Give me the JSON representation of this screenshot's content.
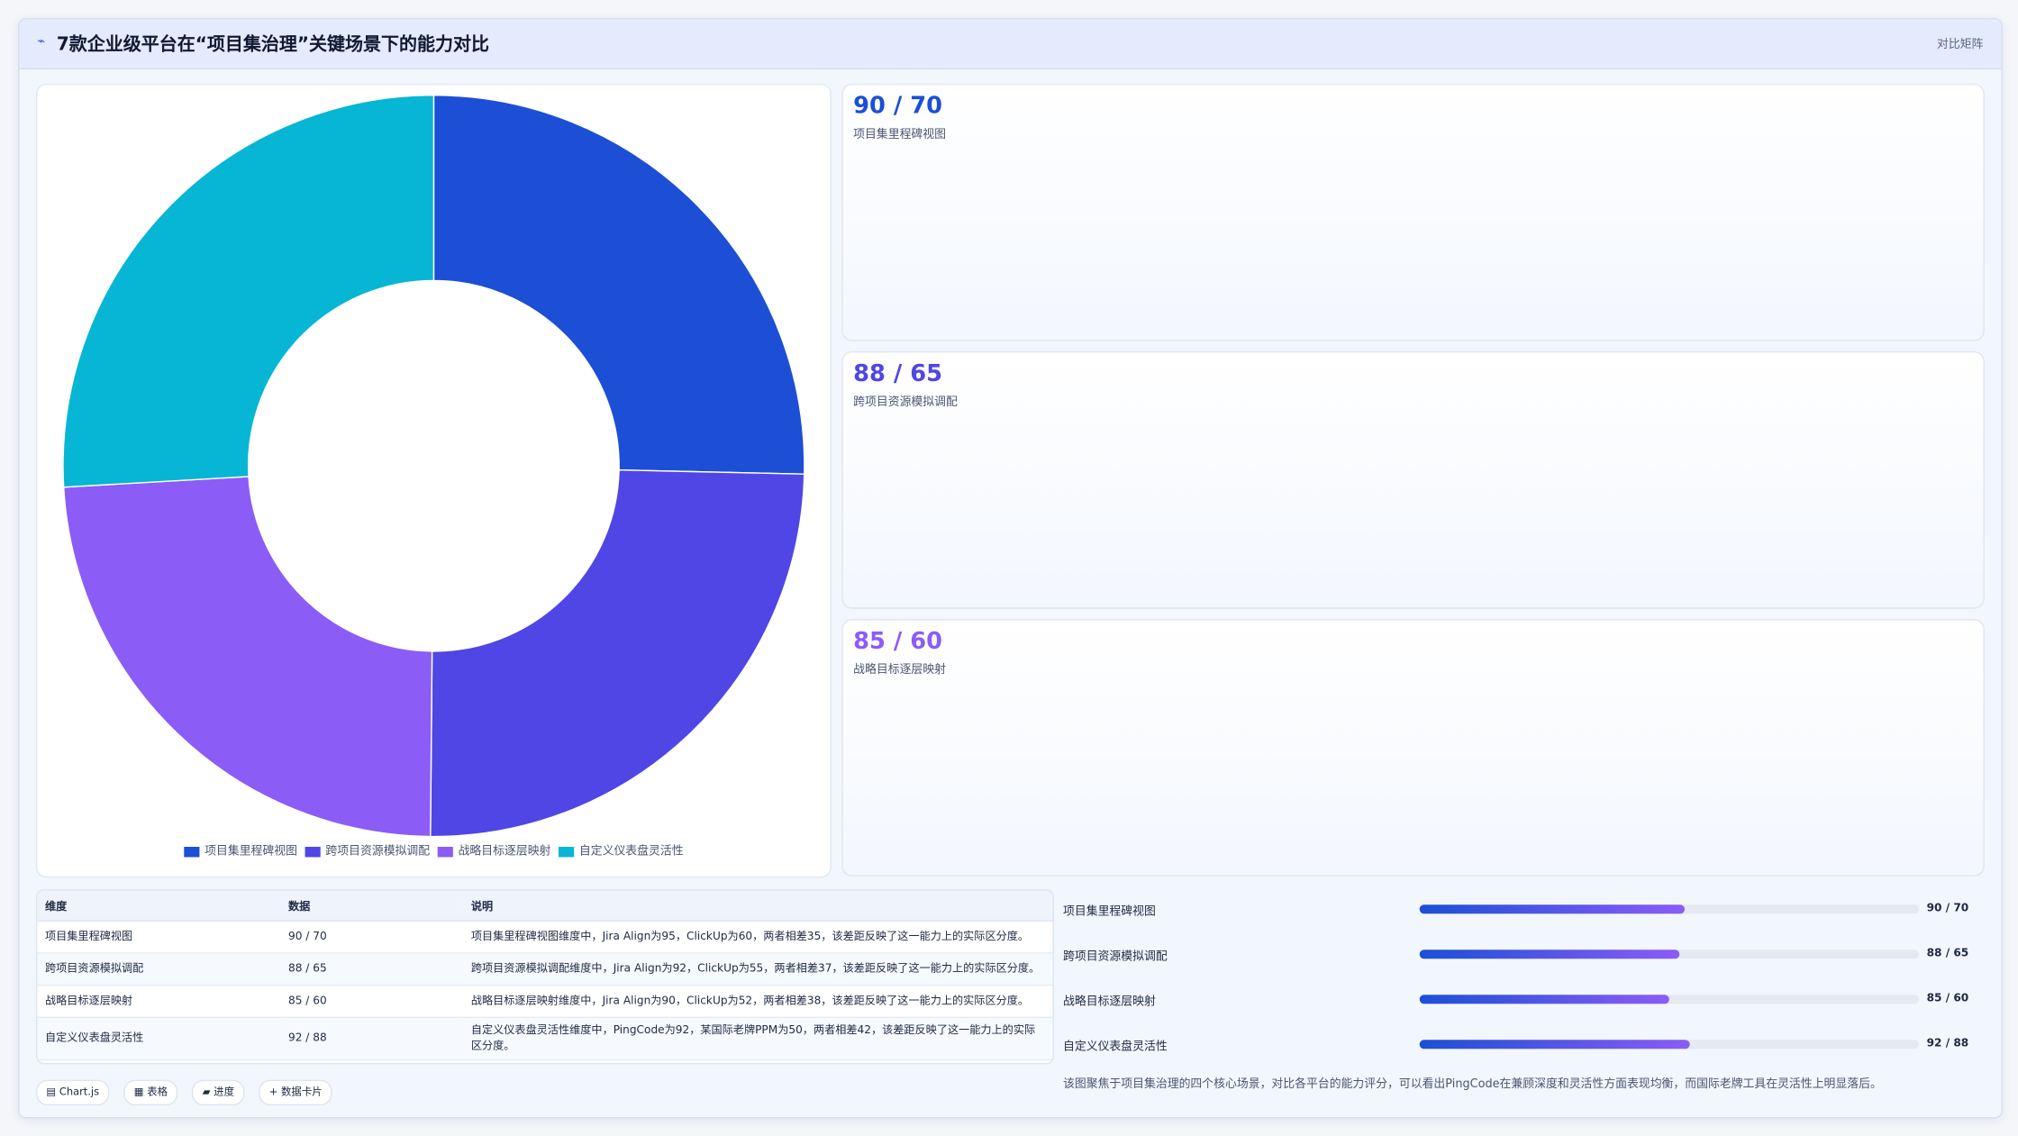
{
  "header": {
    "icon": "chart-line-icon",
    "title": "7款企业级平台在“项目集治理”关键场景下的能力对比",
    "tag": "对比矩阵"
  },
  "chart_data": {
    "type": "doughnut",
    "categories": [
      "项目集里程碑视图",
      "跨项目资源模拟调配",
      "战略目标逐层映射",
      "自定义仪表盘灵活性"
    ],
    "values": [
      90,
      88,
      85,
      92
    ],
    "colors": [
      "#1c4fd6",
      "#4f46e5",
      "#8b5cf6",
      "#06b6d4"
    ],
    "legend_position": "bottom"
  },
  "stats": [
    {
      "value": "90 / 70",
      "label": "项目集里程碑视图",
      "color": "#1c4fd6"
    },
    {
      "value": "88 / 65",
      "label": "跨项目资源模拟调配",
      "color": "#4f46e5"
    },
    {
      "value": "85 / 60",
      "label": "战略目标逐层映射",
      "color": "#8b5cf6"
    }
  ],
  "table": {
    "headers": [
      "维度",
      "数据",
      "说明"
    ],
    "rows": [
      {
        "dim": "项目集里程碑视图",
        "data": "90 / 70",
        "desc": "项目集里程碑视图维度中，Jira Align为95，ClickUp为60，两者相差35，该差距反映了这一能力上的实际区分度。"
      },
      {
        "dim": "跨项目资源模拟调配",
        "data": "88 / 65",
        "desc": "跨项目资源模拟调配维度中，Jira Align为92，ClickUp为55，两者相差37，该差距反映了这一能力上的实际区分度。"
      },
      {
        "dim": "战略目标逐层映射",
        "data": "85 / 60",
        "desc": "战略目标逐层映射维度中，Jira Align为90，ClickUp为52，两者相差38，该差距反映了这一能力上的实际区分度。"
      },
      {
        "dim": "自定义仪表盘灵活性",
        "data": "92 / 88",
        "desc": "自定义仪表盘灵活性维度中，PingCode为92，某国际老牌PPM为50，两者相差42，该差距反映了这一能力上的实际区分度。"
      }
    ]
  },
  "chips": [
    "▤ Chart.js",
    "▦ 表格",
    "▰ 进度",
    "+ 数据卡片"
  ],
  "progress": [
    {
      "label": "项目集里程碑视图",
      "value": "90 / 70",
      "fraction": 0.53
    },
    {
      "label": "跨项目资源模拟调配",
      "value": "88 / 65",
      "fraction": 0.52
    },
    {
      "label": "战略目标逐层映射",
      "value": "85 / 60",
      "fraction": 0.5
    },
    {
      "label": "自定义仪表盘灵活性",
      "value": "92 / 88",
      "fraction": 0.54
    }
  ],
  "summary": "该图聚焦于项目集治理的四个核心场景，对比各平台的能力评分，可以看出PingCode在兼顾深度和灵活性方面表现均衡，而国际老牌工具在灵活性上明显落后。"
}
